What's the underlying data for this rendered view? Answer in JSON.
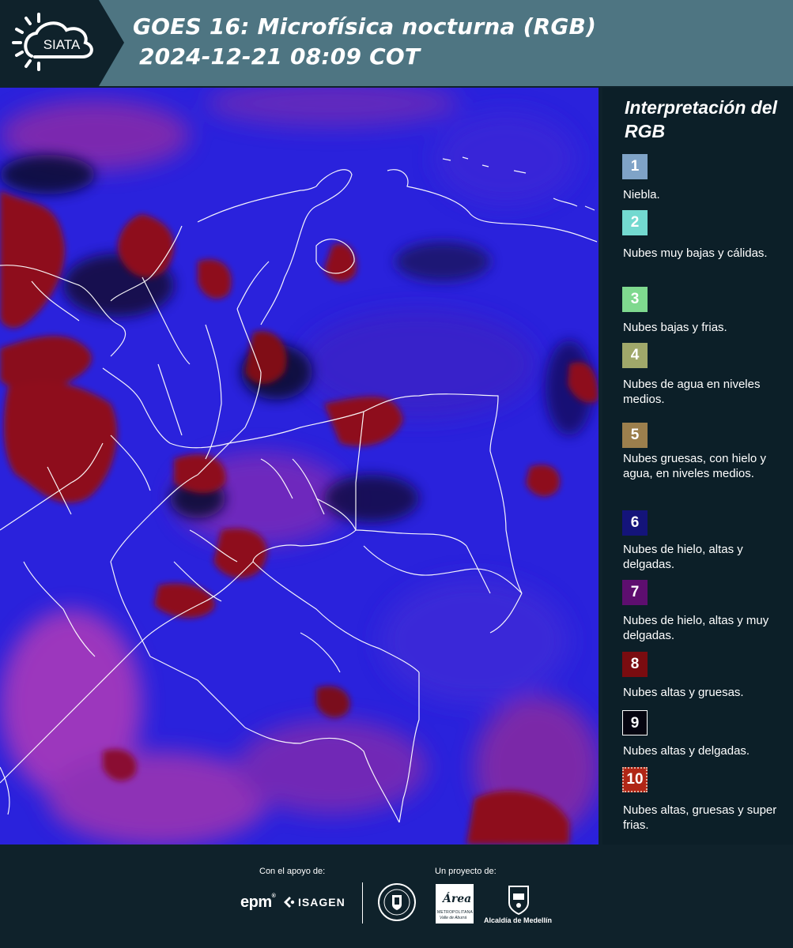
{
  "header": {
    "logo_text": "SIATA",
    "title_line1": "GOES 16: Microfísica nocturna (RGB)",
    "title_line2": "2024-12-21 08:09 COT"
  },
  "map": {
    "icon": "satellite-rgb-map-of-colombia"
  },
  "legend": {
    "title": "Interpretación del RGB",
    "items": [
      {
        "num": "1",
        "label": "Niebla.",
        "color": "#7fa3c7"
      },
      {
        "num": "2",
        "label": "Nubes muy bajas y cálidas.",
        "color": "#73d9d0"
      },
      {
        "num": "3",
        "label": "Nubes bajas y frias.",
        "color": "#7fd98f"
      },
      {
        "num": "4",
        "label": "Nubes de agua en niveles medios.",
        "color": "#a0a86a"
      },
      {
        "num": "5",
        "label": "Nubes gruesas, con hielo y agua, en niveles medios.",
        "color": "#9c7f4d"
      },
      {
        "num": "6",
        "label": "Nubes de hielo, altas y delgadas.",
        "color": "#14147a"
      },
      {
        "num": "7",
        "label": "Nubes de hielo, altas y muy delgadas.",
        "color": "#5e0e6f"
      },
      {
        "num": "8",
        "label": "Nubes altas y gruesas.",
        "color": "#7a0c10"
      },
      {
        "num": "9",
        "label": "Nubes altas y delgadas.",
        "color": "#050510"
      },
      {
        "num": "10",
        "label": "Nubes altas, gruesas y super frias.",
        "color": "#b02616"
      }
    ]
  },
  "footer": {
    "support_label": "Con el apoyo de:",
    "project_label": "Un proyecto de:",
    "epm": "epm",
    "isagen": "ISAGEN",
    "area_main": "Área",
    "area_sub1": "METROPOLITANA",
    "area_sub2": "Valle de Aburrá",
    "alcaldia": "Alcaldía de Medellín"
  }
}
